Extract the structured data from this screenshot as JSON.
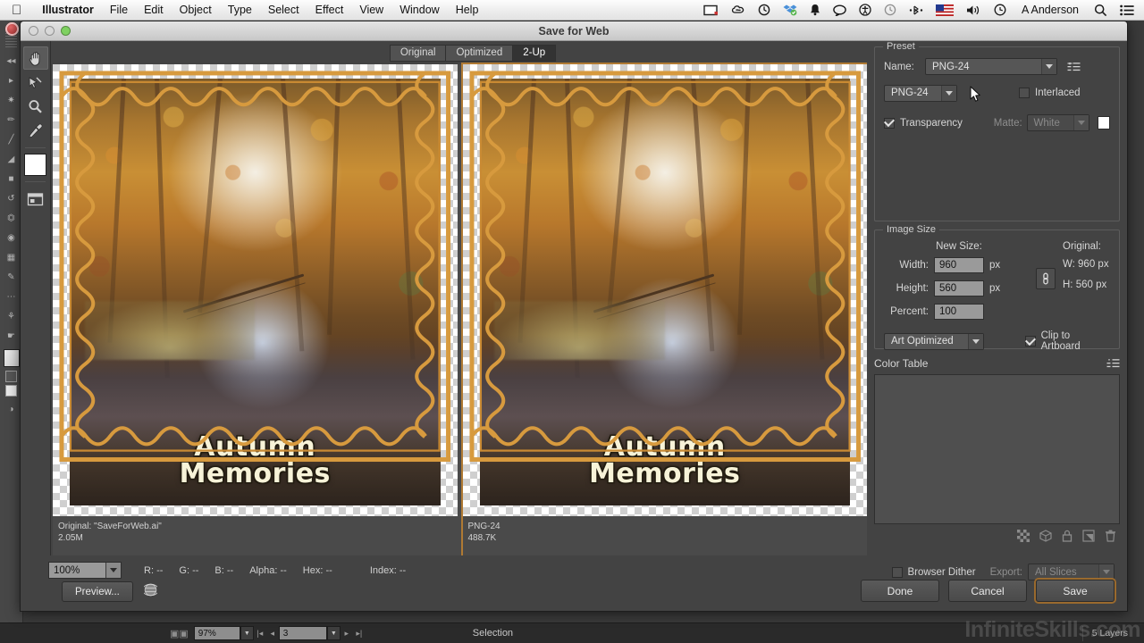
{
  "menubar": {
    "apple_icon": "apple-logo-icon",
    "items": [
      "Illustrator",
      "File",
      "Edit",
      "Object",
      "Type",
      "Select",
      "Effect",
      "View",
      "Window",
      "Help"
    ],
    "app_name": "Illustrator",
    "status_icons": [
      "screen-recorder-icon",
      "creative-cloud-icon",
      "time-machine-icon",
      "dropbox-icon",
      "notifications-bell-icon",
      "messages-bubble-icon",
      "accessibility-icon",
      "clock-history-icon",
      "bluetooth-icon",
      "us-flag-icon",
      "volume-icon",
      "time-icon"
    ],
    "user_name": "A Anderson",
    "search_icon": "search-icon",
    "list_icon": "notification-center-icon"
  },
  "dialog": {
    "title": "Save for Web",
    "window_controls": [
      "close",
      "minimize",
      "zoom"
    ],
    "tools": [
      {
        "name": "hand-tool",
        "icon": "hand-icon",
        "active": true
      },
      {
        "name": "slice-select-tool",
        "icon": "slice-select-icon",
        "active": false
      },
      {
        "name": "zoom-tool",
        "icon": "magnifier-icon",
        "active": false
      },
      {
        "name": "eyedropper-tool",
        "icon": "eyedropper-icon",
        "active": false
      }
    ],
    "tool_swatch_color": "#ffffff",
    "toggle_slices_icon": "toggle-slices-icon",
    "view_tabs": [
      {
        "label": "Original",
        "selected": false
      },
      {
        "label": "Optimized",
        "selected": false
      },
      {
        "label": "2-Up",
        "selected": true
      }
    ]
  },
  "preview": {
    "left": {
      "line1": "Original: \"SaveForWeb.ai\"",
      "line2": "2.05M",
      "selected": false
    },
    "right": {
      "line1": "PNG-24",
      "line2": "488.7K",
      "selected": true
    },
    "artwork_title_line1": "Autumn",
    "artwork_title_line2": "Memories"
  },
  "preset": {
    "group_label": "Preset",
    "name_label": "Name:",
    "name_value": "PNG-24",
    "menu_icon": "panel-menu-icon",
    "format_value": "PNG-24",
    "interlaced_label": "Interlaced",
    "interlaced_checked": false,
    "transparency_label": "Transparency",
    "transparency_checked": true,
    "matte_label": "Matte:",
    "matte_value": "White",
    "matte_enabled": false,
    "matte_swatch": "#ffffff"
  },
  "image_size": {
    "group_label": "Image Size",
    "new_size_label": "New Size:",
    "original_label": "Original:",
    "width_label": "Width:",
    "width_value": "960",
    "width_unit": "px",
    "height_label": "Height:",
    "height_value": "560",
    "height_unit": "px",
    "percent_label": "Percent:",
    "percent_value": "100",
    "link_icon": "chain-link-icon",
    "original_w": "W:  960 px",
    "original_h": "H:  560 px",
    "quality_value": "Art Optimized",
    "clip_label": "Clip to Artboard",
    "clip_checked": true
  },
  "color_table": {
    "title": "Color Table",
    "menu_icon": "panel-menu-icon",
    "icons": [
      "transparency-icon",
      "web-shift-icon",
      "lock-icon",
      "new-color-icon",
      "delete-color-icon"
    ]
  },
  "bottom": {
    "zoom_value": "100%",
    "readouts": [
      {
        "label": "R:",
        "value": "--"
      },
      {
        "label": "G:",
        "value": "--"
      },
      {
        "label": "B:",
        "value": "--"
      },
      {
        "label": "Alpha:",
        "value": "--"
      },
      {
        "label": "Hex:",
        "value": "--"
      },
      {
        "label": "Index:",
        "value": "--"
      }
    ],
    "browser_dither_label": "Browser Dither",
    "browser_dither_checked": false,
    "export_label": "Export:",
    "export_value": "All Slices",
    "export_enabled": false,
    "preview_button": "Preview...",
    "globe_icon": "globe-icon",
    "done_button": "Done",
    "cancel_button": "Cancel",
    "save_button": "Save"
  },
  "app_status": {
    "artboard_icon": "artboard-icon",
    "zoom_value": "97%",
    "page_value": "3",
    "status_text": "Selection",
    "layers_text": "5 Layers",
    "watermark": "InfiniteSkills.com"
  },
  "colors": {
    "dialog_bg": "#434343",
    "accent_orange": "#b07a33",
    "menubar_bg": "#ededed"
  }
}
